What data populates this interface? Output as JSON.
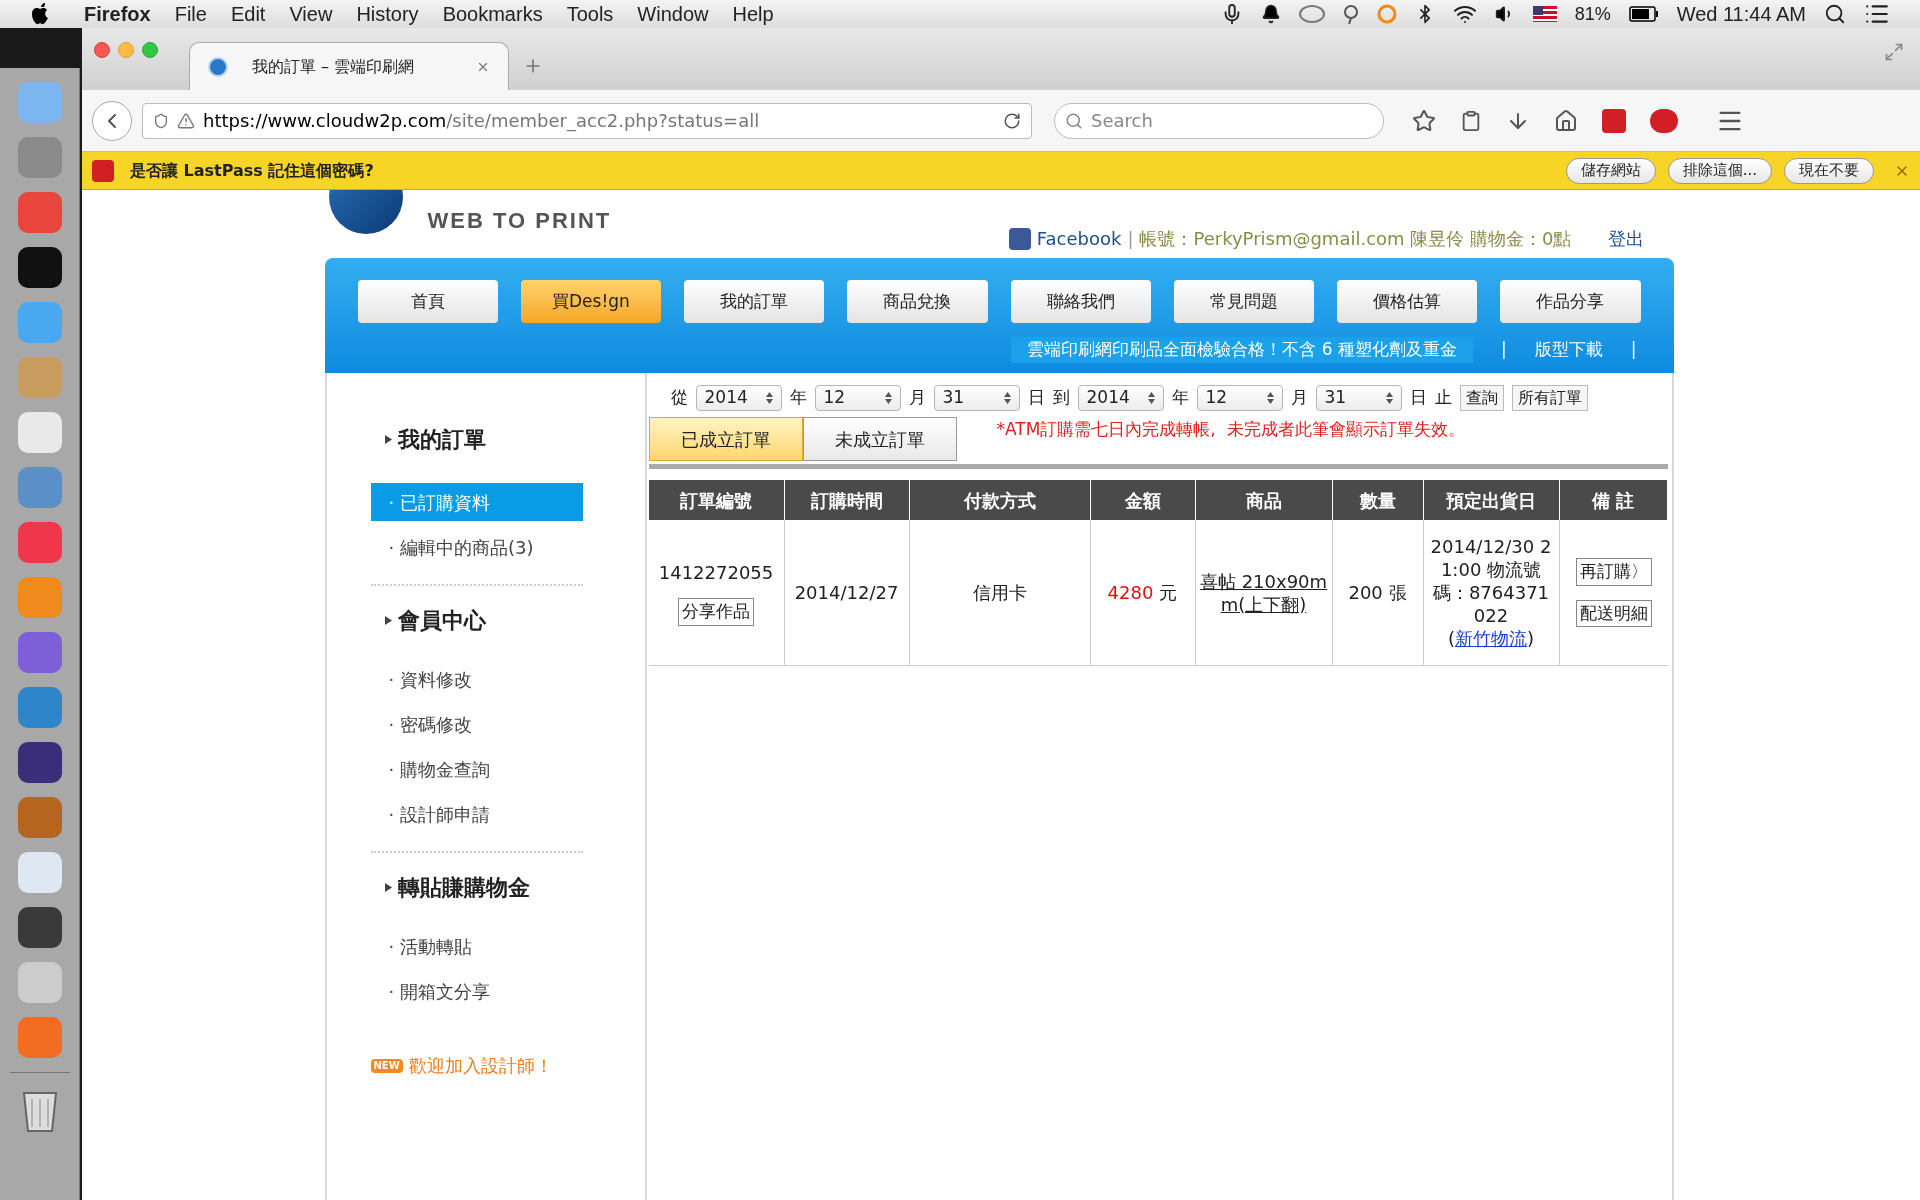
{
  "menu_bar": {
    "app": "Firefox",
    "menus": [
      "File",
      "Edit",
      "View",
      "History",
      "Bookmarks",
      "Tools",
      "Window",
      "Help"
    ],
    "battery": "81%",
    "clock": "Wed 11:44 AM"
  },
  "browser": {
    "tabs": [
      {
        "title": "我的訂單 – 雲端印刷網",
        "selected": true
      }
    ],
    "url_host": "https://www.cloudw2p.com",
    "url_path": "/site/member_acc2.php?status=all",
    "search_placeholder": "Search"
  },
  "lastpass_bar": {
    "message": "是否讓 LastPass 記住這個密碼?",
    "buttons": [
      "儲存網站",
      "排除這個...",
      "現在不要"
    ]
  },
  "header": {
    "brand": "WEB TO PRINT",
    "facebook": "Facebook",
    "separator": "|",
    "account": "帳號：PerkyPrism@gmail.com 陳昱伶 購物金：0點",
    "logout": "登出"
  },
  "nav": [
    {
      "label": "首頁",
      "selected": false
    },
    {
      "label": "買Des!gn",
      "selected": true
    },
    {
      "label": "我的訂單",
      "selected": false
    },
    {
      "label": "商品兌換",
      "selected": false
    },
    {
      "label": "聯絡我們",
      "selected": false
    },
    {
      "label": "常見問題",
      "selected": false
    },
    {
      "label": "價格估算",
      "selected": false
    },
    {
      "label": "作品分享",
      "selected": false
    }
  ],
  "ticker": {
    "headline": "雲端印刷網印刷品全面檢驗合格！不含 6 種塑化劑及重金",
    "separator": "|",
    "link": "版型下載"
  },
  "sidebar": {
    "sections": [
      {
        "title": "我的訂單",
        "items": [
          {
            "label": "已訂購資料",
            "selected": true
          },
          {
            "label": "編輯中的商品(3)",
            "selected": false
          }
        ]
      },
      {
        "title": "會員中心",
        "items": [
          {
            "label": "資料修改",
            "selected": false
          },
          {
            "label": "密碼修改",
            "selected": false
          },
          {
            "label": "購物金查詢",
            "selected": false
          },
          {
            "label": "設計師申請",
            "selected": false
          }
        ]
      },
      {
        "title": "轉貼賺購物金",
        "items": [
          {
            "label": "活動轉貼",
            "selected": false
          },
          {
            "label": "開箱文分享",
            "selected": false
          }
        ]
      }
    ],
    "bullet": "·",
    "promo": {
      "badge": "NEW",
      "text": "歡迎加入設計師！"
    }
  },
  "date_filter": {
    "from_label": "從",
    "to_label": "到",
    "end_label": "止",
    "from": [
      {
        "value": "2014",
        "unit": "年"
      },
      {
        "value": "12",
        "unit": "月"
      },
      {
        "value": "31",
        "unit": "日"
      }
    ],
    "to": [
      {
        "value": "2014",
        "unit": "年"
      },
      {
        "value": "12",
        "unit": "月"
      },
      {
        "value": "31",
        "unit": "日"
      }
    ],
    "buttons": [
      "查詢",
      "所有訂單"
    ]
  },
  "order_tabs": [
    {
      "label": "已成立訂單",
      "selected": true
    },
    {
      "label": "未成立訂單",
      "selected": false
    }
  ],
  "notice": "*ATM訂購需七日內完成轉帳,  未完成者此筆會顯示訂單失效。",
  "table": {
    "columns": [
      "訂單編號",
      "訂購時間",
      "付款方式",
      "金額",
      "商品",
      "數量",
      "預定出貨日",
      "備 註"
    ],
    "rows": [
      {
        "order_no": "1412272055",
        "share_button": "分享作品",
        "date": "2014/12/27",
        "payment": "信用卡",
        "amount": "4280",
        "currency": "元",
        "product": "喜帖 210x90mm(上下翻)",
        "quantity": "200 張",
        "ship": "2014/12/30 21:00 物流號碼：8764371022",
        "carrier_open": "(",
        "carrier": "新竹物流",
        "carrier_close": ")",
        "buttons": [
          "再訂購〉",
          "配送明細"
        ]
      }
    ]
  }
}
